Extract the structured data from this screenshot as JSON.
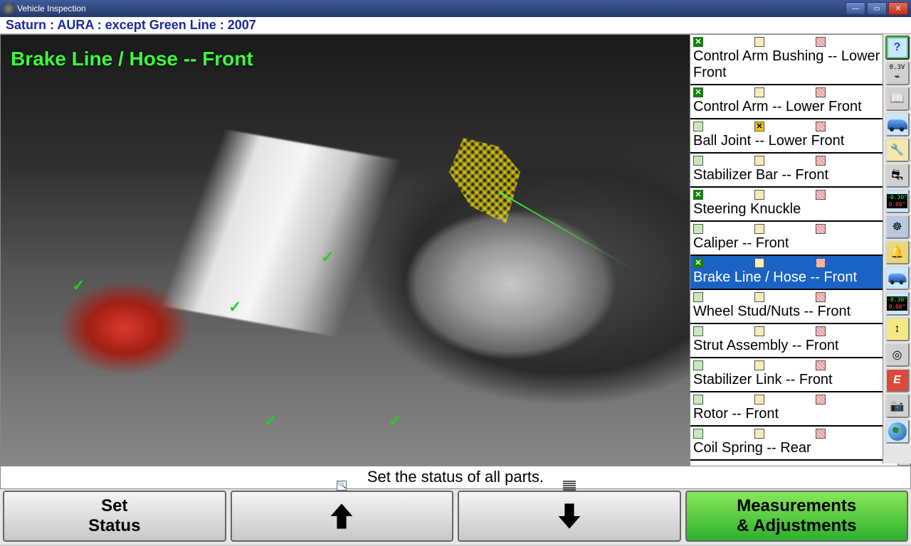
{
  "window": {
    "title": "Vehicle Inspection"
  },
  "vehicle": {
    "line": "Saturn : AURA : except Green Line : 2007"
  },
  "photo": {
    "label": "Brake Line / Hose -- Front"
  },
  "parts": [
    {
      "label": "Control Arm Bushing -- Lower Front",
      "green": "checked",
      "yellow": "",
      "red": "",
      "cam": false,
      "selected": false
    },
    {
      "label": "Control Arm -- Lower Front",
      "green": "checked",
      "yellow": "",
      "red": "",
      "cam": false,
      "selected": false
    },
    {
      "label": "Ball Joint -- Lower Front",
      "green": "",
      "yellow": "checked",
      "red": "",
      "cam": true,
      "selected": false
    },
    {
      "label": "Stabilizer Bar -- Front",
      "green": "",
      "yellow": "",
      "red": "",
      "cam": false,
      "selected": false
    },
    {
      "label": "Steering Knuckle",
      "green": "checked",
      "yellow": "",
      "red": "",
      "cam": false,
      "selected": false
    },
    {
      "label": "Caliper -- Front",
      "green": "",
      "yellow": "",
      "red": "",
      "cam": false,
      "selected": false
    },
    {
      "label": "Brake Line / Hose -- Front",
      "green": "checked",
      "yellow": "",
      "red": "",
      "cam": false,
      "selected": true
    },
    {
      "label": "Wheel Stud/Nuts -- Front",
      "green": "",
      "yellow": "",
      "red": "",
      "cam": false,
      "selected": false
    },
    {
      "label": "Strut Assembly -- Front",
      "green": "",
      "yellow": "",
      "red": "",
      "cam": false,
      "selected": false
    },
    {
      "label": "Stabilizer Link -- Front",
      "green": "",
      "yellow": "",
      "red": "",
      "cam": false,
      "selected": false
    },
    {
      "label": "Rotor -- Front",
      "green": "",
      "yellow": "",
      "red": "",
      "cam": false,
      "selected": false
    },
    {
      "label": "Coil Spring -- Rear",
      "green": "",
      "yellow": "",
      "red": "",
      "cam": false,
      "selected": false
    }
  ],
  "right_toolbar": {
    "volt_label": "0.3V",
    "meas1_top": "-0.30°",
    "meas1_bot": "0.00°",
    "meas2_top": "-0.30°",
    "meas2_bot": "0.00°",
    "express_label": "E"
  },
  "hint": "Set the status of all parts.",
  "buttons": {
    "set_status_l1": "Set",
    "set_status_l2": "Status",
    "meas_l1": "Measurements",
    "meas_l2": "& Adjustments"
  }
}
